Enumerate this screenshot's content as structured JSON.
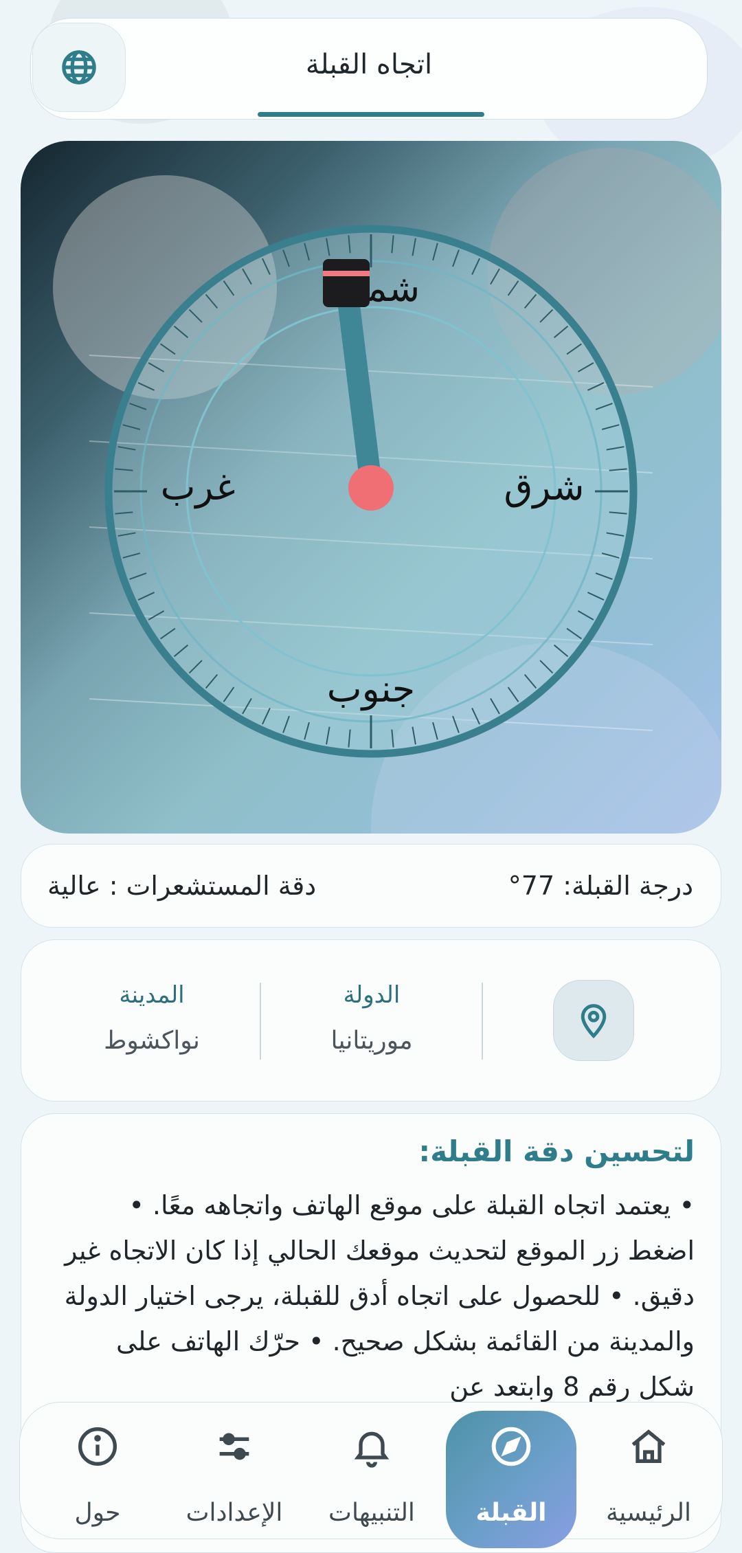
{
  "header": {
    "title": "اتجاه القبلة"
  },
  "compass": {
    "north": "شمال",
    "east": "شرق",
    "west": "غرب",
    "south": "جنوب"
  },
  "info": {
    "degree": "درجة القبلة: 77°",
    "accuracy": "دقة المستشعرات : عالية"
  },
  "location": {
    "country_label": "الدولة",
    "country_value": "موريتانيا",
    "city_label": "المدينة",
    "city_value": "نواكشوط"
  },
  "tips": {
    "title": "لتحسين دقة القبلة:",
    "body": "• يعتمد اتجاه القبلة على موقع الهاتف واتجاهه معًا. • اضغط زر الموقع لتحديث موقعك الحالي إذا كان الاتجاه غير دقيق. • للحصول على اتجاه أدق للقبلة، يرجى اختيار الدولة والمدينة من القائمة بشكل صحيح. • حرّك الهاتف على شكل رقم 8 وابتعد عن"
  },
  "nav": {
    "items": [
      {
        "label": "الرئيسية",
        "icon": "home-icon"
      },
      {
        "label": "القبلة",
        "icon": "compass-icon",
        "active": true
      },
      {
        "label": "التنبيهات",
        "icon": "bell-icon"
      },
      {
        "label": "الإعدادات",
        "icon": "sliders-icon"
      },
      {
        "label": "حول",
        "icon": "info-icon"
      }
    ]
  },
  "colors": {
    "accent": "#2f7d8a",
    "needle": "#3f8696",
    "needle_tip": "#ef6f75",
    "ring": "#3a7f8e",
    "kaaba_band": "#f07a82"
  }
}
